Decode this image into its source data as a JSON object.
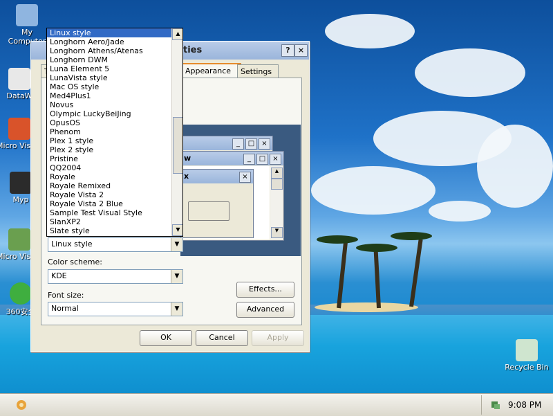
{
  "desktop": {
    "icons": [
      {
        "label": "My Computer"
      },
      {
        "label": "DataW"
      },
      {
        "label": "Micro Visual"
      },
      {
        "label": "Myp"
      },
      {
        "label": "Micro Visual"
      },
      {
        "label": "360安全"
      },
      {
        "label": "Recycle Bin"
      }
    ]
  },
  "dialog": {
    "title": "ties",
    "help_button": "?",
    "close_button": "×",
    "tabs": [
      "T",
      "Appearance",
      "Settings"
    ],
    "preview": {
      "win1_title": "",
      "win2_title": "w",
      "msg_title": "x"
    },
    "windows_buttons_value": "Linux style",
    "color_scheme_label": "Color scheme:",
    "color_scheme_value": "KDE",
    "font_size_label": "Font size:",
    "font_size_value": "Normal",
    "effects_button": "Effects...",
    "advanced_button": "Advanced",
    "ok_button": "OK",
    "cancel_button": "Cancel",
    "apply_button": "Apply"
  },
  "dropdown": {
    "selected_index": 0,
    "items": [
      "Linux style",
      "Longhorn Aero/Jade",
      "Longhorn Athens/Atenas",
      "Longhorn DWM",
      "Luna Element 5",
      "LunaVista style",
      "Mac OS style",
      "Med4Plus1",
      "Novus",
      "Olympic LuckyBeiJing",
      "OpusOS",
      "Phenom",
      "Plex 1 style",
      "Plex 2 style",
      "Pristine",
      "QQ2004",
      "Royale",
      "Royale Remixed",
      "Royale Vista 2",
      "Royale Vista 2 Blue",
      "Sample Test Visual Style",
      "SlanXP2",
      "Slate style"
    ]
  },
  "taskbar": {
    "clock": "9:08 PM"
  }
}
